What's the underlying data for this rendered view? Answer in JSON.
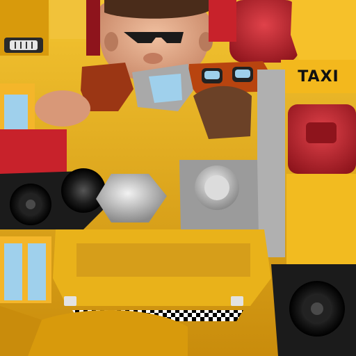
{
  "texture": {
    "sign_text": "TAXI",
    "palette": {
      "taxi_yellow": "#e9b21a",
      "deep_yellow": "#d8960c",
      "red": "#c8222b",
      "dark_red": "#8e141c",
      "skin": "#e0a685",
      "mustache_brown": "#6b4127",
      "goggle_orange": "#b8440f",
      "glass_blue": "#9fd0ec",
      "chrome": "#bdbdbd",
      "tire_black": "#1b1b1b",
      "checker_white": "#ffffff",
      "checker_black": "#000000"
    }
  }
}
